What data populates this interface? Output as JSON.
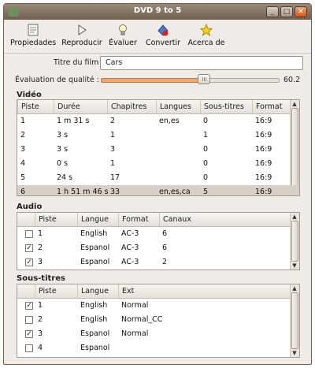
{
  "window": {
    "title": "DVD 9 to 5",
    "minimize": "_",
    "maximize": "□",
    "close": "✕"
  },
  "toolbar": [
    {
      "label": "Propiedades",
      "icon": "properties-icon"
    },
    {
      "label": "Reproducir",
      "icon": "play-icon"
    },
    {
      "label": "Évaluer",
      "icon": "evaluate-icon"
    },
    {
      "label": "Convertir",
      "icon": "convert-icon"
    },
    {
      "label": "Acerca de",
      "icon": "about-star-icon"
    }
  ],
  "form": {
    "title_label": "Titre du film :",
    "title_value": "Cars",
    "quality_label": "Évaluation de qualité :",
    "quality_value": "60.2",
    "quality_fraction": 0.58
  },
  "video": {
    "section": "Vidéo",
    "headers": [
      "Piste",
      "Durée",
      "Chapitres",
      "Langues",
      "Sous-titres",
      "Format"
    ],
    "rows": [
      [
        "1",
        "1 m 31 s",
        "2",
        "en,es",
        "0",
        "16:9"
      ],
      [
        "2",
        "3 s",
        "1",
        "",
        "1",
        "16:9"
      ],
      [
        "3",
        "3 s",
        "3",
        "",
        "0",
        "16:9"
      ],
      [
        "4",
        "0 s",
        "1",
        "",
        "0",
        "16:9"
      ],
      [
        "5",
        "24 s",
        "17",
        "",
        "0",
        "16:9"
      ],
      [
        "6",
        "1 h 51 m 46 s",
        "33",
        "en,es,ca",
        "5",
        "16:9"
      ]
    ],
    "selected_row": 5
  },
  "audio": {
    "section": "Audio",
    "headers": [
      "Piste",
      "Langue",
      "Format",
      "Canaux"
    ],
    "rows": [
      {
        "checked": false,
        "cells": [
          "1",
          "English",
          "AC-3",
          "6"
        ]
      },
      {
        "checked": true,
        "cells": [
          "2",
          "Espanol",
          "AC-3",
          "6"
        ]
      },
      {
        "checked": true,
        "cells": [
          "3",
          "Espanol",
          "AC-3",
          "2"
        ]
      }
    ]
  },
  "subtitles": {
    "section": "Sous-titres",
    "headers": [
      "Piste",
      "Langue",
      "Ext"
    ],
    "rows": [
      {
        "checked": true,
        "cells": [
          "1",
          "English",
          "Normal"
        ]
      },
      {
        "checked": false,
        "cells": [
          "2",
          "English",
          "Normal_CC"
        ]
      },
      {
        "checked": true,
        "cells": [
          "3",
          "Espanol",
          "Normal"
        ]
      },
      {
        "checked": false,
        "cells": [
          "4",
          "Espanol",
          ""
        ]
      }
    ]
  },
  "colors": {
    "accent": "#f1a673",
    "selection": "#d8cfc6",
    "titlebar": "#7f6f60"
  }
}
